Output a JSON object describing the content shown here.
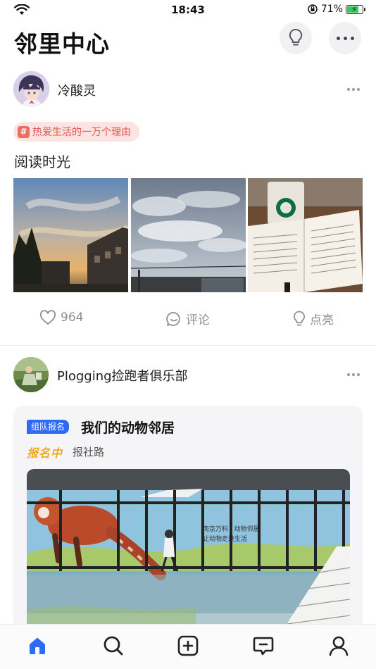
{
  "status_bar": {
    "time": "18:43",
    "battery_percent": "71%",
    "battery_level": 0.71
  },
  "header": {
    "title": "邻里中心"
  },
  "post1": {
    "author": "冷酸灵",
    "topic": "热爱生活的一万个理由",
    "topic_hash": "#",
    "text": "阅读时光",
    "images": [
      "sunset-sky-photo",
      "cloudy-sky-photo",
      "starbucks-book-photo"
    ],
    "likes": "964",
    "comment_label": "评论",
    "light_label": "点亮"
  },
  "post2": {
    "author": "Plogging捡跑者俱乐部",
    "event": {
      "type_badge": "组队报名",
      "title": "我们的动物邻居",
      "status": "报名中",
      "location": "报社路"
    }
  },
  "tab_bar": {
    "items": [
      "home-icon",
      "search-icon",
      "add-icon",
      "message-icon",
      "profile-icon"
    ],
    "active": "home-icon"
  },
  "colors": {
    "accent": "#2c6bf2",
    "tag_bg": "#fde3e1",
    "tag_text": "#e0564c",
    "status": "#f5a623"
  }
}
